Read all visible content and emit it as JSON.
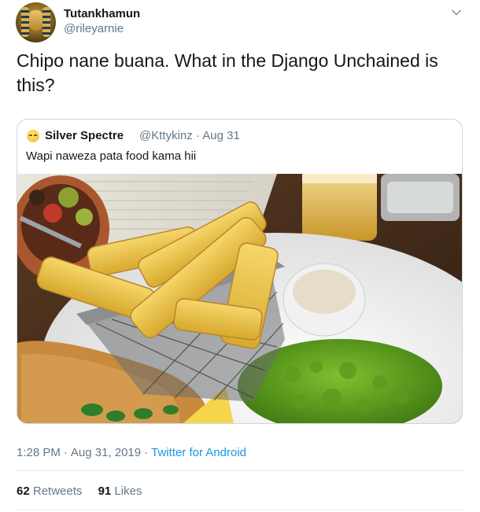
{
  "author": {
    "display_name": "Tutankhamun",
    "handle": "@rileyarnie"
  },
  "tweet_text": "Chipo nane buana. What in the Django Unchained is this?",
  "quoted_tweet": {
    "author_name": "Silver Spectre",
    "author_handle": "@Kttykinz",
    "separator": "·",
    "date": "Aug 31",
    "text": "Wapi naweza pata food kama hii",
    "emoji_icon": "rolling-eyes-emoji-icon",
    "photo_subject": "fish-and-chips-photo"
  },
  "footer": {
    "time": "1:28 PM",
    "separator": "·",
    "date": "Aug 31, 2019",
    "source": "Twitter for Android",
    "retweets_count": "62",
    "retweets_label": "Retweets",
    "likes_count": "91",
    "likes_label": "Likes"
  },
  "colors": {
    "text_primary": "#14171a",
    "text_secondary": "#657786",
    "link": "#1b95e0",
    "border": "#ccd6dd"
  }
}
